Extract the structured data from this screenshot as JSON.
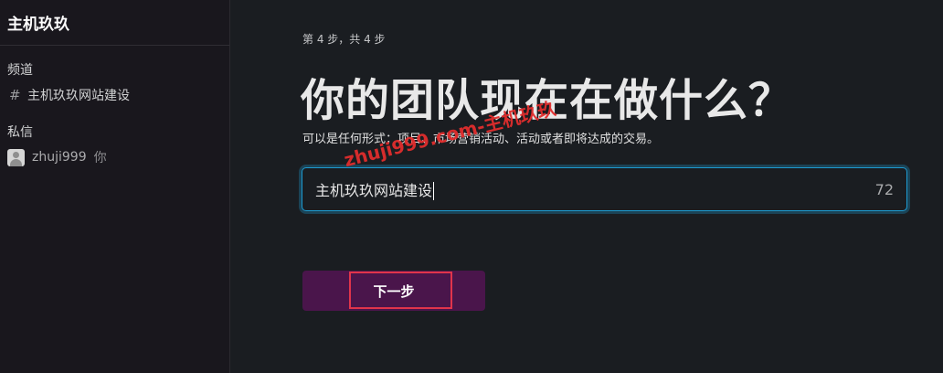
{
  "sidebar": {
    "workspace_name": "主机玖玖",
    "channels_label": "频道",
    "channels": [
      {
        "icon": "hash-icon",
        "label": "主机玖玖网站建设"
      }
    ],
    "dms_label": "私信",
    "dms": [
      {
        "name": "zhuji999",
        "you_label": "你"
      }
    ]
  },
  "main": {
    "step_text": "第 4 步，共 4 步",
    "headline": "你的团队现在在做什么？",
    "subtext": "可以是任何形式：项目、市场营销活动、活动或者即将达成的交易。",
    "input": {
      "value": "主机玖玖网站建设",
      "remaining_count": "72"
    },
    "next_button_label": "下一步"
  },
  "watermark": "zhuji999.com-主机玖玖",
  "colors": {
    "sidebar_bg": "#19171d",
    "main_bg": "#1a1d21",
    "button_bg": "#4a154b",
    "focus_ring": "#1d9bd1",
    "annotation_red": "#e0344b"
  }
}
